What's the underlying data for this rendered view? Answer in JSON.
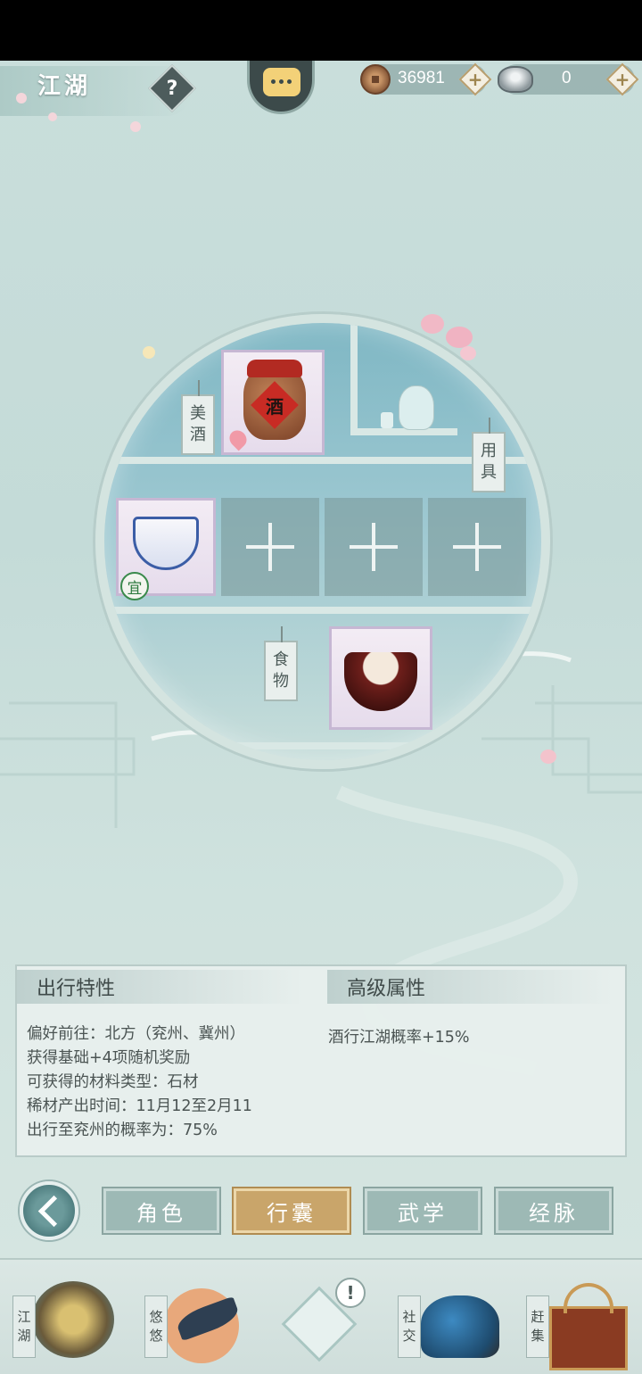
{
  "header": {
    "title": "江湖",
    "help_label": "?",
    "copper": "36981",
    "silver": "0",
    "add_label": "+"
  },
  "shelf": {
    "tags": {
      "wine": [
        "美",
        "酒"
      ],
      "tools": [
        "用",
        "具"
      ],
      "food": [
        "食",
        "物"
      ]
    },
    "wine_jar_label": "酒",
    "suitable_badge": "宜",
    "empty_slot_count": 3
  },
  "info": {
    "travel_title": "出行特性",
    "advanced_title": "高级属性",
    "lines": [
      "偏好前往：北方（兖州、冀州）",
      "获得基础+4项随机奖励",
      "可获得的材料类型：石材",
      "稀材产出时间：11月12至2月11",
      "出行至兖州的概率为：75%"
    ],
    "advanced_lines": [
      "酒行江湖概率+15%"
    ]
  },
  "tabs": [
    {
      "label": "角色",
      "active": false
    },
    {
      "label": "行囊",
      "active": true
    },
    {
      "label": "武学",
      "active": false
    },
    {
      "label": "经脉",
      "active": false
    }
  ],
  "bottom_nav": [
    {
      "label": [
        "江",
        "湖"
      ],
      "icon": "straw-hat-icon"
    },
    {
      "label": [
        "悠",
        "悠"
      ],
      "icon": "swallow-icon"
    },
    {
      "label": [],
      "icon": "compass-star-icon",
      "alert": "!"
    },
    {
      "label": [
        "社",
        "交"
      ],
      "icon": "wave-icon"
    },
    {
      "label": [
        "赶",
        "集"
      ],
      "icon": "market-basket-icon"
    }
  ],
  "colors": {
    "accent_gold": "#c9a56a",
    "tab_teal": "#9db9b5",
    "item_border_purple": "#c6b7d3"
  }
}
